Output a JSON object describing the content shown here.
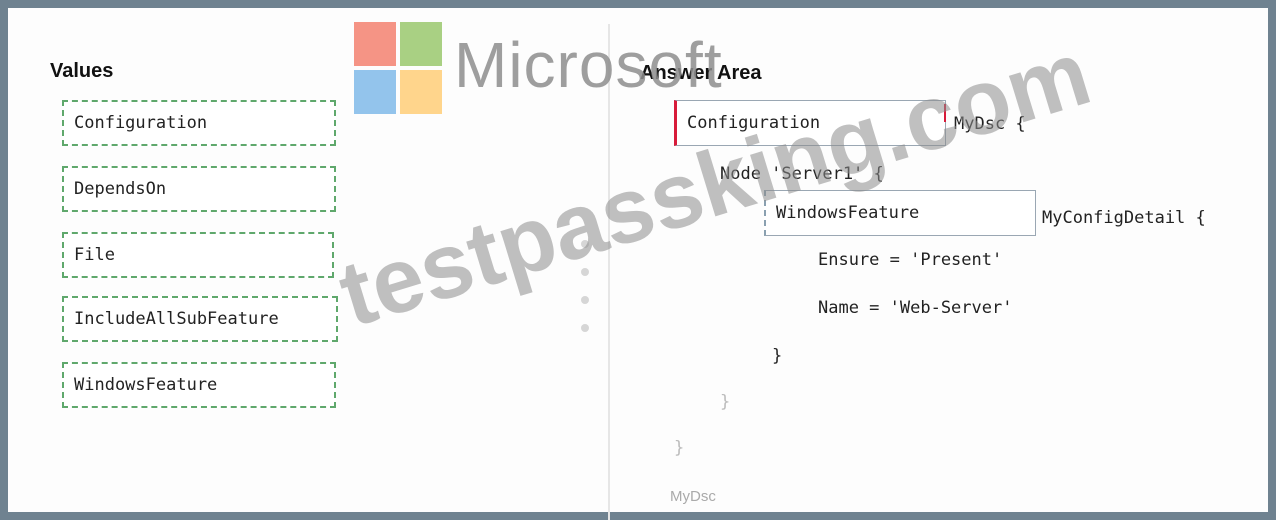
{
  "left_panel": {
    "title": "Values",
    "values": [
      "Configuration",
      "DependsOn",
      "File",
      "IncludeAllSubFeature",
      "WindowsFeature"
    ]
  },
  "answer_area": {
    "title": "Answer Area",
    "slot1_value": "Configuration",
    "slot2_value": "WindowsFeature",
    "line_mydsc": "MyDsc {",
    "line_node": "Node 'Server1' {",
    "line_detail": "MyConfigDetail {",
    "line_ensure": "Ensure = 'Present'",
    "line_name": "Name = 'Web-Server'",
    "brace_inner": "}",
    "brace_node": "}",
    "brace_outer": "}",
    "footer": "MyDsc"
  },
  "overlay": {
    "brand_text": "Microsoft",
    "watermark_text": "testpassking.com"
  },
  "colors": {
    "dashed_border": "#5fa86c",
    "frame": "#6f8290",
    "accent_red": "#d81b3a"
  }
}
